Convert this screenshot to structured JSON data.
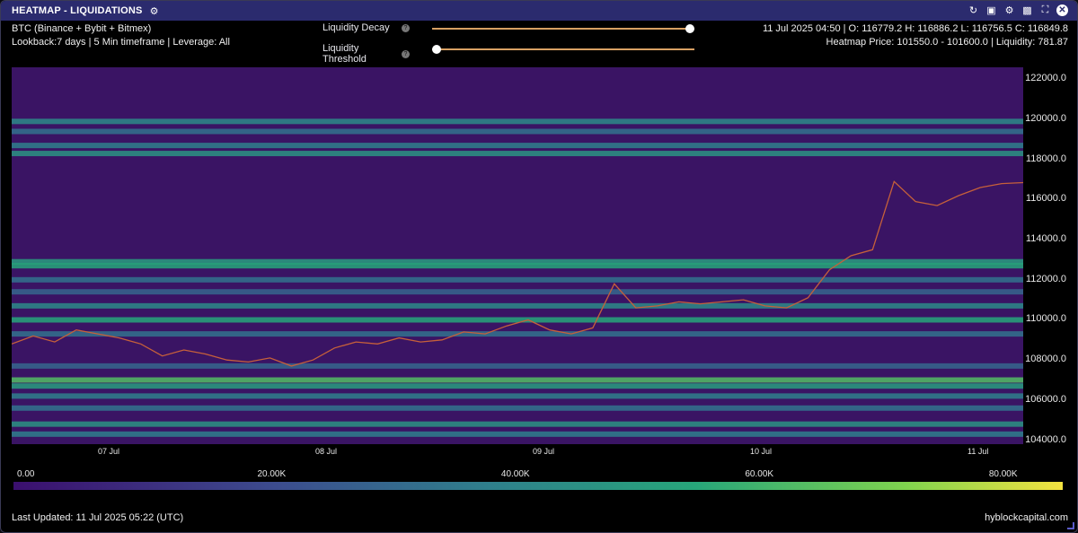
{
  "window": {
    "title": "HEATMAP - LIQUIDATIONS",
    "icons": [
      "settings-sliders-icon",
      "refresh-icon",
      "camera-icon",
      "gear-icon",
      "save-icon",
      "fullscreen-icon",
      "close-icon"
    ]
  },
  "info": {
    "exchanges": "BTC (Binance + Bybit + Bitmex)",
    "params": "Lookback:7 days | 5 Min timeframe | Leverage: All",
    "ohlc": "11 Jul 2025 04:50 | O: 116779.2 H: 116886.2 L: 116756.5 C: 116849.8",
    "heatmap_price": "Heatmap Price: 101550.0 - 101600.0 | Liquidity: 781.87"
  },
  "sliders": {
    "decay_label": "Liquidity Decay",
    "threshold_label": "Liquidity Threshold",
    "decay_value": 1.0,
    "threshold_value": 0.0
  },
  "chart_data": {
    "type": "heatmap",
    "y_ticks": [
      "122000.0",
      "120000.0",
      "118000.0",
      "116000.0",
      "114000.0",
      "112000.0",
      "110000.0",
      "108000.0",
      "106000.0",
      "104000.0"
    ],
    "ylim": [
      103800,
      122600
    ],
    "x_ticks": [
      "07 Jul",
      "08 Jul",
      "09 Jul",
      "10 Jul",
      "11 Jul"
    ],
    "colorbar_ticks": [
      "0.00",
      "20.00K",
      "40.00K",
      "60.00K",
      "80.00K"
    ],
    "colorbar_colors": [
      "#3b0f6e",
      "#3c4c8e",
      "#2f7f8c",
      "#27a67a",
      "#7fd34e",
      "#f5e340"
    ],
    "price_series": [
      108800,
      109200,
      108900,
      109500,
      109300,
      109100,
      108800,
      108200,
      108500,
      108300,
      108000,
      107900,
      108100,
      107700,
      108000,
      108600,
      108900,
      108800,
      109100,
      108900,
      109000,
      109400,
      109300,
      109700,
      110000,
      109500,
      109300,
      109600,
      111800,
      110600,
      110700,
      110900,
      110800,
      110900,
      111000,
      110700,
      110600,
      111100,
      112500,
      113200,
      113500,
      116900,
      115900,
      115700,
      116200,
      116600,
      116800,
      116849.8
    ],
    "bands": [
      {
        "price": 119900,
        "intensity": 0.45
      },
      {
        "price": 119400,
        "intensity": 0.35
      },
      {
        "price": 118700,
        "intensity": 0.4
      },
      {
        "price": 118300,
        "intensity": 0.5
      },
      {
        "price": 112900,
        "intensity": 0.55
      },
      {
        "price": 112700,
        "intensity": 0.6
      },
      {
        "price": 112000,
        "intensity": 0.35
      },
      {
        "price": 111400,
        "intensity": 0.3
      },
      {
        "price": 110700,
        "intensity": 0.45
      },
      {
        "price": 110000,
        "intensity": 0.6
      },
      {
        "price": 109300,
        "intensity": 0.35
      },
      {
        "price": 107700,
        "intensity": 0.3
      },
      {
        "price": 107000,
        "intensity": 0.7
      },
      {
        "price": 106700,
        "intensity": 0.55
      },
      {
        "price": 106200,
        "intensity": 0.4
      },
      {
        "price": 105600,
        "intensity": 0.35
      },
      {
        "price": 104800,
        "intensity": 0.5
      },
      {
        "price": 104300,
        "intensity": 0.4
      }
    ]
  },
  "footer": {
    "last_updated": "Last Updated: 11 Jul 2025 05:22 (UTC)",
    "brand": "hyblockcapital.com"
  }
}
